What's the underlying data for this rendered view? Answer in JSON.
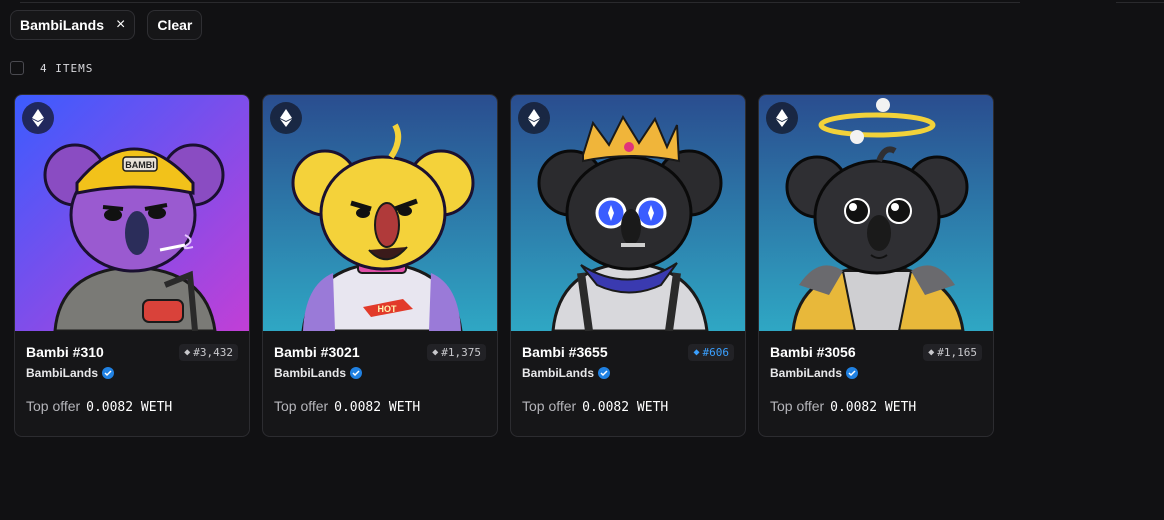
{
  "filters": {
    "chips": [
      {
        "label": "BambiLands",
        "removable": true
      },
      {
        "label": "Clear",
        "removable": false
      }
    ],
    "remove_icon": "×"
  },
  "results": {
    "count_label": "4 ITEMS"
  },
  "card_common": {
    "collection": "BambiLands",
    "offer_label": "Top offer",
    "chain_icon": "ethereum-icon",
    "verified_icon": "verified-check-icon"
  },
  "items": [
    {
      "name": "Bambi #310",
      "rank": "#3,432",
      "rank_color": "#c8c8cc",
      "offer_value": "0.0082 WETH",
      "bg_from": "#3b5cff",
      "bg_to": "#c23fd6",
      "fur": "#9a5ad0",
      "accessory": "yellow-beanie"
    },
    {
      "name": "Bambi #3021",
      "rank": "#1,375",
      "rank_color": "#c8c8cc",
      "offer_value": "0.0082 WETH",
      "bg_from": "#2a4d8f",
      "bg_to": "#2fa7c4",
      "fur": "#f4d23a",
      "accessory": "hotwheels-shirt"
    },
    {
      "name": "Bambi #3655",
      "rank": "#606",
      "rank_color": "#3aa0ff",
      "offer_value": "0.0082 WETH",
      "bg_from": "#2a4d8f",
      "bg_to": "#2fa7c4",
      "fur": "#2b2b2e",
      "accessory": "gold-crown"
    },
    {
      "name": "Bambi #3056",
      "rank": "#1,165",
      "rank_color": "#c8c8cc",
      "offer_value": "0.0082 WETH",
      "bg_from": "#2a4d8f",
      "bg_to": "#2fa7c4",
      "fur": "#2f2f33",
      "accessory": "halo"
    }
  ]
}
